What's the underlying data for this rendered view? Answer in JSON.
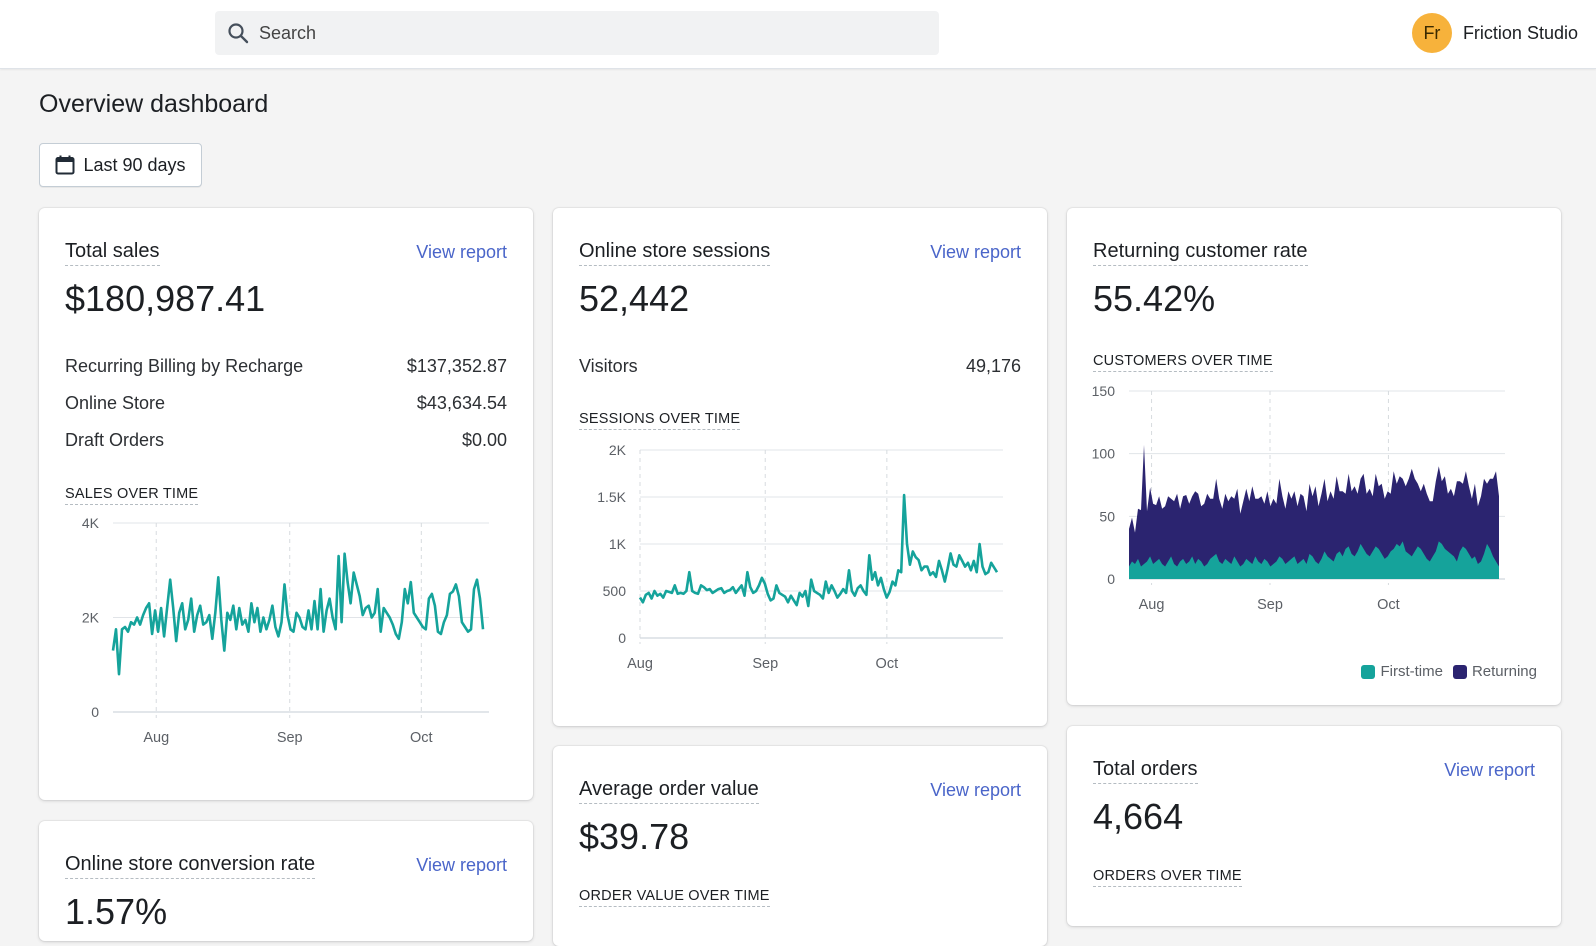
{
  "topbar": {
    "search_placeholder": "Search",
    "store_initials": "Fr",
    "store_name": "Friction Studio"
  },
  "page": {
    "title": "Overview dashboard",
    "date_range": "Last 90 days"
  },
  "colors": {
    "teal": "#15a39b",
    "returning": "#2b2470",
    "link": "#4a65c9",
    "avatar": "#f7b23b"
  },
  "cards": {
    "total_sales": {
      "title": "Total sales",
      "link": "View report",
      "value": "$180,987.41",
      "breakdown": [
        {
          "label": "Recurring Billing by Recharge",
          "value": "$137,352.87"
        },
        {
          "label": "Online Store",
          "value": "$43,634.54"
        },
        {
          "label": "Draft Orders",
          "value": "$0.00"
        }
      ],
      "chart_title": "SALES OVER TIME"
    },
    "sessions": {
      "title": "Online store sessions",
      "link": "View report",
      "value": "52,442",
      "breakdown": [
        {
          "label": "Visitors",
          "value": "49,176"
        }
      ],
      "chart_title": "SESSIONS OVER TIME"
    },
    "returning": {
      "title": "Returning customer rate",
      "value": "55.42%",
      "chart_title": "CUSTOMERS OVER TIME",
      "legend": [
        "First-time",
        "Returning"
      ]
    },
    "aov": {
      "title": "Average order value",
      "link": "View report",
      "value": "$39.78",
      "chart_title": "ORDER VALUE OVER TIME"
    },
    "orders": {
      "title": "Total orders",
      "link": "View report",
      "value": "4,664",
      "chart_title": "ORDERS OVER TIME"
    },
    "conversion": {
      "title": "Online store conversion rate",
      "link": "View report",
      "value": "1.57%"
    }
  },
  "chart_data": [
    {
      "id": "sales",
      "type": "line",
      "title": "SALES OVER TIME",
      "x_ticks": [
        "Aug",
        "Sep",
        "Oct"
      ],
      "y_ticks": [
        "0",
        "2K",
        "4K"
      ],
      "ylim": [
        0,
        4000
      ],
      "grid": true,
      "series": [
        {
          "color": "#15a39b",
          "values": [
            1300,
            1750,
            800,
            1750,
            1800,
            1700,
            1900,
            1850,
            2000,
            1850,
            2050,
            2200,
            2300,
            1650,
            2150,
            1700,
            2200,
            1600,
            2200,
            2800,
            2200,
            1500,
            2100,
            2300,
            1750,
            1950,
            2400,
            1700,
            2050,
            2250,
            1850,
            1900,
            2050,
            1550,
            2100,
            2850,
            1950,
            1300,
            2100,
            1950,
            2250,
            1750,
            2200,
            1850,
            1950,
            1700,
            2300,
            1900,
            2200,
            1700,
            2000,
            1750,
            1950,
            2250,
            1800,
            1600,
            1900,
            2700,
            2050,
            1750,
            1700,
            2100,
            2000,
            1800,
            1750,
            2150,
            1750,
            2350,
            1750,
            2600,
            1700,
            2150,
            2400,
            2000,
            1750,
            3300,
            1900,
            3350,
            2750,
            2300,
            2950,
            2700,
            2450,
            2050,
            2200,
            2250,
            2000,
            2100,
            2600,
            1700,
            2200,
            2100,
            2000,
            1850,
            1650,
            1550,
            1900,
            2600,
            2300,
            2750,
            2100,
            2000,
            1900,
            1800,
            1750,
            2400,
            2500,
            2250,
            1700,
            1650,
            1900,
            2050,
            2500,
            2550,
            2700,
            2450,
            1900,
            1800,
            1700,
            1750,
            2600,
            2800,
            2400,
            1750
          ],
          "note": ""
        }
      ]
    },
    {
      "id": "sessions",
      "type": "line",
      "title": "SESSIONS OVER TIME",
      "x_ticks": [
        "Aug",
        "Sep",
        "Oct"
      ],
      "y_ticks": [
        "0",
        "500",
        "1K",
        "1.5K",
        "2K"
      ],
      "ylim": [
        0,
        2000
      ],
      "grid": true,
      "series": [
        {
          "color": "#15a39b",
          "values": [
            430,
            380,
            460,
            480,
            420,
            500,
            450,
            470,
            430,
            500,
            490,
            480,
            560,
            470,
            480,
            470,
            500,
            700,
            500,
            480,
            470,
            560,
            540,
            510,
            520,
            480,
            500,
            520,
            530,
            480,
            500,
            510,
            540,
            480,
            520,
            560,
            450,
            700,
            540,
            480,
            500,
            560,
            640,
            580,
            470,
            400,
            420,
            560,
            480,
            460,
            440,
            380,
            450,
            400,
            350,
            480,
            440,
            500,
            340,
            620,
            500,
            480,
            460,
            420,
            600,
            480,
            560,
            500,
            430,
            470,
            520,
            480,
            720,
            500,
            450,
            530,
            560,
            500,
            460,
            880,
            620,
            700,
            560,
            640,
            520,
            430,
            490,
            600,
            560,
            720,
            700,
            1520,
            1000,
            780,
            920,
            860,
            830,
            720,
            760,
            760,
            670,
            700,
            650,
            820,
            720,
            600,
            740,
            900,
            780,
            760,
            880,
            820,
            760,
            800,
            720,
            820,
            700,
            1000,
            760,
            680,
            700,
            800,
            750,
            700
          ]
        }
      ]
    },
    {
      "id": "customers",
      "type": "area",
      "title": "CUSTOMERS OVER TIME",
      "x_ticks": [
        "Aug",
        "Sep",
        "Oct"
      ],
      "y_ticks": [
        "0",
        "50",
        "100",
        "150"
      ],
      "ylim": [
        0,
        150
      ],
      "grid": true,
      "series": [
        {
          "name": "First-time",
          "color": "#15a39b",
          "values": [
            10,
            14,
            12,
            16,
            10,
            12,
            14,
            18,
            12,
            14,
            16,
            12,
            10,
            14,
            18,
            12,
            10,
            14,
            16,
            12,
            14,
            18,
            12,
            16,
            14,
            10,
            12,
            16,
            18,
            20,
            14,
            12,
            16,
            14,
            12,
            18,
            14,
            10,
            12,
            16,
            14,
            12,
            18,
            14,
            12,
            16,
            14,
            10,
            12,
            14,
            18,
            16,
            12,
            14,
            16,
            18,
            12,
            14,
            16,
            12,
            20,
            18,
            14,
            12,
            16,
            22,
            18,
            16,
            14,
            20,
            22,
            18,
            24,
            26,
            20,
            18,
            22,
            28,
            24,
            20,
            18,
            22,
            26,
            24,
            20,
            16,
            18,
            22,
            24,
            28,
            26,
            30,
            22,
            20,
            18,
            22,
            26,
            24,
            20,
            16,
            14,
            18,
            22,
            30,
            28,
            24,
            22,
            20,
            18,
            14,
            22,
            26,
            24,
            20,
            16,
            18,
            12,
            14,
            20,
            28,
            24,
            18,
            14,
            10
          ]
        },
        {
          "name": "Returning",
          "color": "#2b2470",
          "values": [
            30,
            35,
            25,
            40,
            45,
            95,
            40,
            55,
            48,
            45,
            50,
            44,
            48,
            52,
            46,
            50,
            58,
            42,
            50,
            55,
            46,
            48,
            58,
            52,
            44,
            50,
            56,
            48,
            46,
            60,
            50,
            44,
            52,
            48,
            54,
            46,
            58,
            42,
            50,
            56,
            48,
            62,
            46,
            50,
            54,
            44,
            56,
            48,
            52,
            46,
            62,
            50,
            44,
            56,
            48,
            52,
            46,
            54,
            50,
            42,
            56,
            48,
            60,
            46,
            52,
            58,
            44,
            54,
            50,
            62,
            48,
            52,
            44,
            58,
            50,
            56,
            46,
            52,
            60,
            48,
            54,
            44,
            58,
            50,
            56,
            48,
            52,
            46,
            62,
            48,
            56,
            50,
            52,
            60,
            70,
            58,
            50,
            46,
            56,
            52,
            48,
            44,
            56,
            60,
            50,
            58,
            46,
            52,
            48,
            64,
            56,
            50,
            62,
            54,
            48,
            58,
            46,
            52,
            60,
            48,
            56,
            62,
            72,
            56
          ]
        }
      ]
    }
  ]
}
